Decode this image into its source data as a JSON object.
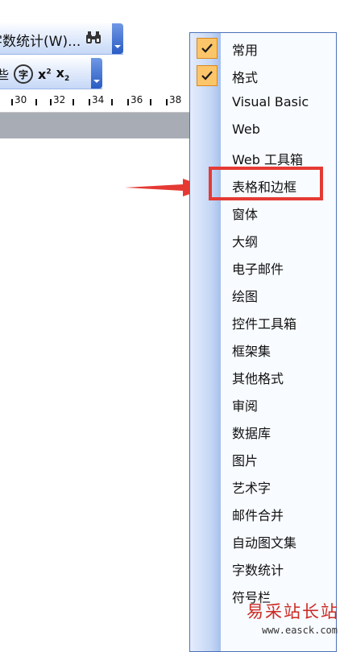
{
  "toolbar1": {
    "label": "字数统计(W)..."
  },
  "toolbar2": {
    "icons": [
      "format-icon",
      "phonetic-guide-icon",
      "superscript-icon",
      "subscript-icon"
    ],
    "phonetic_glyph": "字",
    "superscript_glyph": "x²",
    "subscript_glyph": "x₂"
  },
  "ruler": {
    "labels": [
      "30",
      "32",
      "34",
      "36",
      "38"
    ]
  },
  "menu": {
    "items": [
      {
        "label": "常用",
        "checked": true
      },
      {
        "label": "格式",
        "checked": true
      },
      {
        "label": "Visual Basic",
        "checked": false
      },
      {
        "label": "Web",
        "checked": false
      },
      {
        "label": "Web 工具箱",
        "checked": false
      },
      {
        "label": "表格和边框",
        "checked": false,
        "highlighted": true
      },
      {
        "label": "窗体",
        "checked": false
      },
      {
        "label": "大纲",
        "checked": false
      },
      {
        "label": "电子邮件",
        "checked": false
      },
      {
        "label": "绘图",
        "checked": false
      },
      {
        "label": "控件工具箱",
        "checked": false
      },
      {
        "label": "框架集",
        "checked": false
      },
      {
        "label": "其他格式",
        "checked": false
      },
      {
        "label": "审阅",
        "checked": false
      },
      {
        "label": "数据库",
        "checked": false
      },
      {
        "label": "图片",
        "checked": false
      },
      {
        "label": "艺术字",
        "checked": false
      },
      {
        "label": "邮件合并",
        "checked": false
      },
      {
        "label": "自动图文集",
        "checked": false
      },
      {
        "label": "字数统计",
        "checked": false
      },
      {
        "label": "符号栏",
        "checked": false
      }
    ]
  },
  "annotation": {
    "arrow_color": "#e53a34",
    "highlight_color": "#e53a34"
  },
  "watermark": {
    "title": "易采站长站",
    "url": "www.easck.com"
  },
  "colors": {
    "check_bg": "#fbc56a",
    "menu_border": "#4d71b8",
    "toolbar_chevron": "#2a5cc4"
  }
}
